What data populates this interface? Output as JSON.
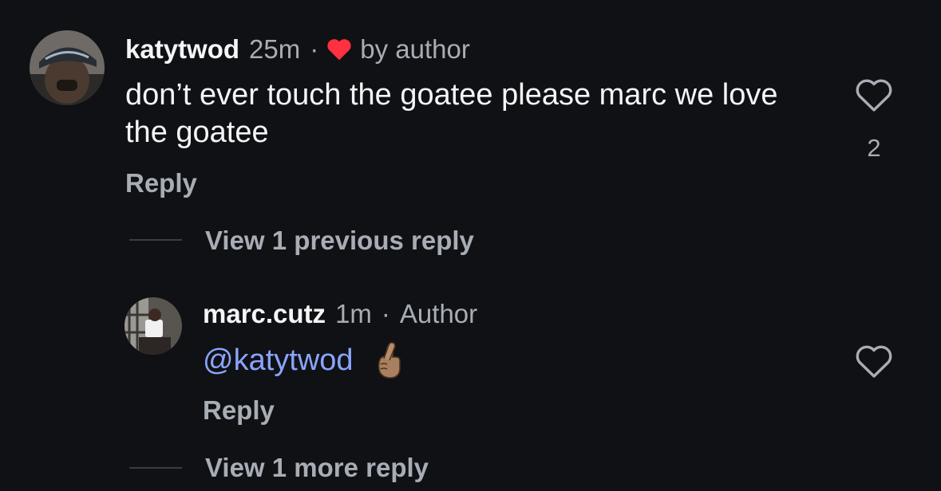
{
  "comments": [
    {
      "username": "katytwod",
      "time": "25m",
      "separator": "·",
      "liked_by_author_label": "by author",
      "text": "don’t ever touch the goatee please marc we love the goatee",
      "reply_label": "Reply",
      "like_count": "2",
      "heart_icon": "heart-outline-icon",
      "author_heart_color": "#ff3040"
    },
    {
      "username": "marc.cutz",
      "time": "1m",
      "separator": "·",
      "badge": "Author",
      "mention": "@katytwod",
      "emoji": "🤞🏽",
      "reply_label": "Reply",
      "heart_icon": "heart-outline-icon"
    }
  ],
  "view_previous_replies": "View 1 previous reply",
  "view_more_replies": "View 1 more reply",
  "colors": {
    "background": "#0f1114",
    "primary_text": "#f3f5f7",
    "secondary_text": "#a8adb5",
    "mention": "#8aa4ff",
    "like_red": "#ff3040"
  }
}
